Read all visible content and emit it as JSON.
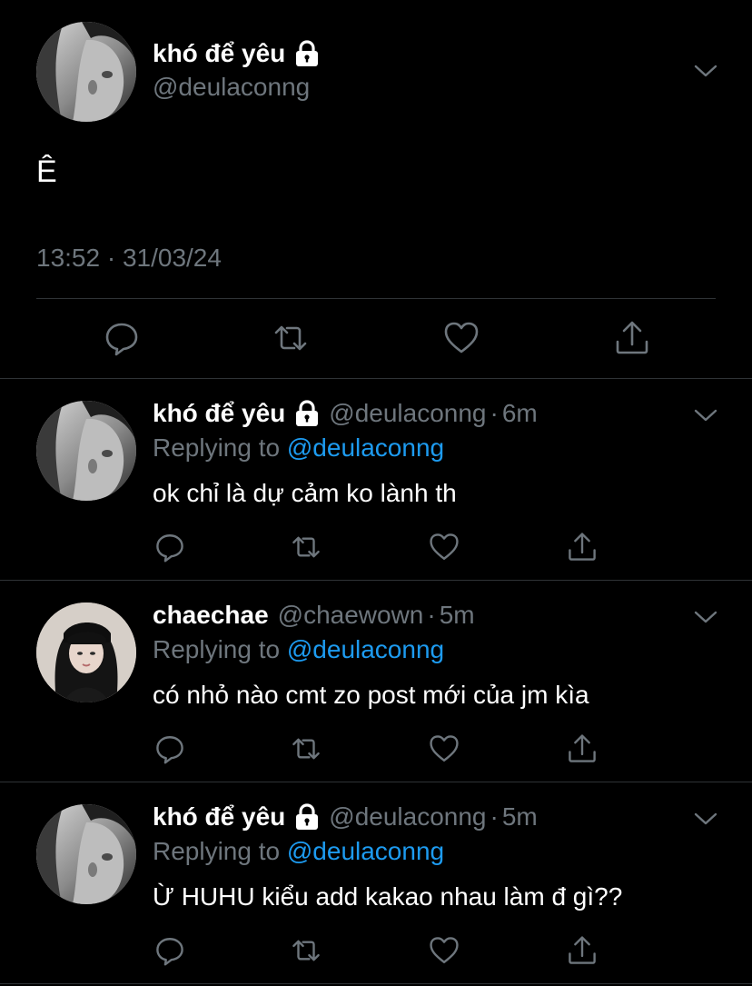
{
  "main_tweet": {
    "display_name": "khó để yêu",
    "handle": "@deulaconng",
    "text": "Ê",
    "timestamp": "13:52 · 31/03/24",
    "icons": {
      "lock": "lock-icon",
      "more": "chevron-down-icon",
      "reply": "reply-icon",
      "retweet": "retweet-icon",
      "like": "heart-icon",
      "share": "share-icon"
    }
  },
  "replies": [
    {
      "display_name": "khó để yêu",
      "handle": "@deulaconng",
      "separator": "·",
      "time": "6m",
      "replying_prefix": "Replying to",
      "replying_mention": "@deulaconng",
      "text": "ok chỉ là dự cảm ko lành th",
      "locked": true
    },
    {
      "display_name": "chaechae",
      "handle": "@chaewown",
      "separator": "·",
      "time": "5m",
      "replying_prefix": "Replying to",
      "replying_mention": "@deulaconng",
      "text": "có nhỏ nào cmt zo post mới của jm kìa",
      "locked": false
    },
    {
      "display_name": "khó để yêu",
      "handle": "@deulaconng",
      "separator": "·",
      "time": "5m",
      "replying_prefix": "Replying to",
      "replying_mention": "@deulaconng",
      "text": "Ừ HUHU kiểu add kakao nhau làm đ gì??",
      "locked": true
    }
  ],
  "colors": {
    "background": "#000000",
    "text_primary": "#ffffff",
    "text_secondary": "#6e767d",
    "link": "#1d9bf0",
    "divider": "#2f3336"
  }
}
